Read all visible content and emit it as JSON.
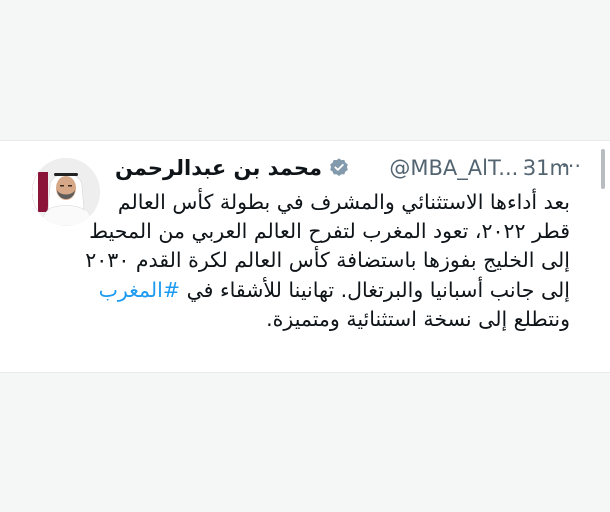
{
  "tweet": {
    "author": {
      "display_name": "محمد بن عبدالرحمن",
      "handle": "@MBA_AlT...",
      "verified": true,
      "verified_color": "#829aab"
    },
    "separator": "·",
    "timestamp": "31m",
    "more_icon": "more-horizontal-icon",
    "body": {
      "text_before": "بعد أداءها الاستثنائي والمشرف في بطولة كأس العالم قطر ٢٠٢٢، تعود المغرب لتفرح العالم العربي من المحيط إلى الخليج بفوزها باستضافة كأس العالم لكرة القدم ٢٠٣٠ إلى جانب أسبانيا والبرتغال. تهانينا للأشقاء في ",
      "hashtag": "#المغرب",
      "text_after": " ونتطلع إلى نسخة استثنائية ومتميزة."
    }
  },
  "colors": {
    "text": "#0f1419",
    "secondary": "#536471",
    "link": "#1d9bf0",
    "background": "#f5f6f6",
    "card": "#ffffff"
  }
}
